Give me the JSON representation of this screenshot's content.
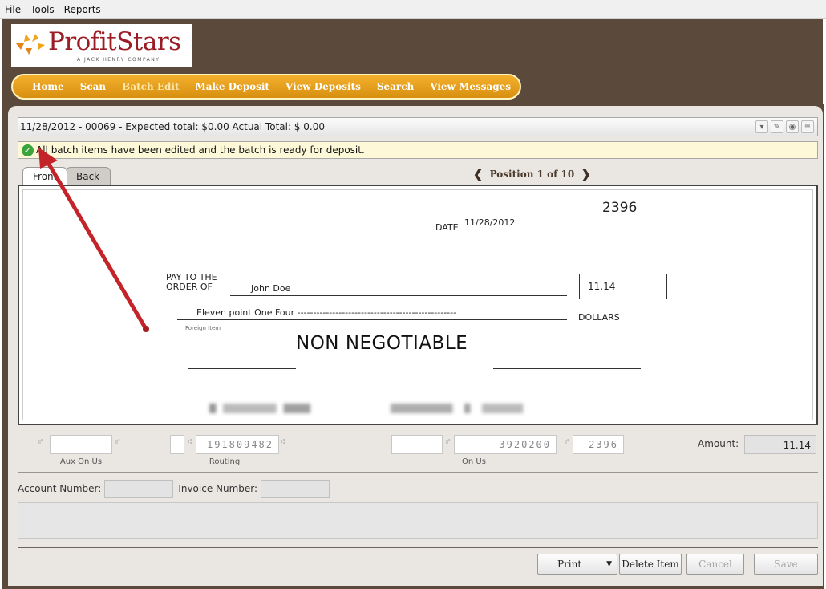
{
  "menu": {
    "items": [
      "File",
      "Tools",
      "Reports"
    ]
  },
  "brand": {
    "name": "ProfitStars",
    "sub": "A JACK HENRY COMPANY"
  },
  "nav": {
    "items": [
      "Home",
      "Scan",
      "Batch Edit",
      "Make Deposit",
      "View Deposits",
      "Search",
      "View Messages"
    ],
    "active": "Batch Edit"
  },
  "batch": {
    "summary": "11/28/2012 - 00069 -  Expected total: $0.00     Actual Total: $ 0.00"
  },
  "status": {
    "message": "All batch items have been edited and the batch is ready for deposit."
  },
  "tabs": {
    "front": "Front",
    "back": "Back"
  },
  "position": {
    "label": "Position 1 of 10"
  },
  "check": {
    "number": "2396",
    "date_label": "DATE",
    "date": "11/28/2012",
    "pay_label_1": "PAY TO THE",
    "pay_label_2": "ORDER OF",
    "payee": "John Doe",
    "amount": "11.14",
    "amount_words": "Eleven point One Four --------------------------------------------------",
    "dollars": "DOLLARS",
    "memo": "Foreign Item",
    "watermark": "NON NEGOTIABLE"
  },
  "micr": {
    "aux_on_us_label": "Aux On Us",
    "routing_value": "191809482",
    "routing_label": "Routing",
    "on_us_value": "3920200",
    "on_us_label": "On Us",
    "check_num_value": "2396",
    "amount_label": "Amount:",
    "amount_value": "11.14"
  },
  "fields": {
    "account_label": "Account Number:",
    "invoice_label": "Invoice Number:"
  },
  "buttons": {
    "print": "Print",
    "delete": "Delete Item",
    "cancel": "Cancel",
    "save": "Save"
  },
  "colors": {
    "brown": "#5b4a3c",
    "orange": "#f3b02d",
    "brand_red": "#9b1d23",
    "arrow": "#c4232a",
    "status_bg": "#fdf9d8"
  }
}
